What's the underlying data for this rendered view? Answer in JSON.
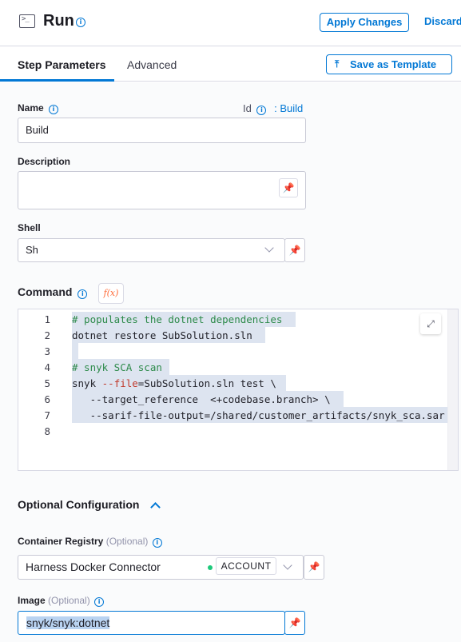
{
  "header": {
    "title": "Run",
    "apply_label": "Apply Changes",
    "discard_label": "Discard"
  },
  "tabs": {
    "step_parameters": "Step Parameters",
    "advanced": "Advanced",
    "save_template": "Save as Template"
  },
  "form": {
    "name_label": "Name",
    "id_label": "Id",
    "id_value": ": Build",
    "name_value": "Build",
    "description_label": "Description",
    "description_value": "",
    "shell_label": "Shell",
    "shell_value": "Sh",
    "command_label": "Command",
    "fx_label": "f(x)"
  },
  "editor": {
    "line_numbers": [
      "1",
      "2",
      "3",
      "4",
      "5",
      "6",
      "7",
      "8"
    ],
    "lines": [
      "# populates the dotnet dependencies",
      "dotnet restore SubSolution.sln",
      "",
      "# snyk SCA scan",
      "snyk --file=SubSolution.sln test \\",
      "   --target_reference  <+codebase.branch> \\",
      "   --sarif-file-output=/shared/customer_artifacts/snyk_sca.sar",
      ""
    ]
  },
  "optional": {
    "section_title": "Optional Configuration",
    "registry_label": "Container Registry",
    "registry_optional": "(Optional)",
    "registry_value": "Harness Docker Connector",
    "registry_scope": "ACCOUNT",
    "image_label": "Image",
    "image_optional": "(Optional)",
    "image_value": "snyk/snyk:dotnet"
  },
  "colors": {
    "accent": "#0278d5",
    "connected": "#1ec97b",
    "comment": "#2d8a4a"
  }
}
